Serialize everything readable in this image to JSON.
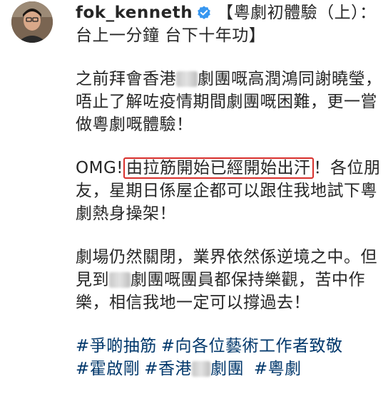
{
  "post": {
    "username": "fok_kenneth",
    "title": "【粵劇初體驗（上）：台上一分鐘 台下十年功】",
    "para1_a": "之前拜會香港",
    "para1_b": "劇團嘅高潤鴻同謝曉瑩，唔止了解咗疫情期間劇團嘅困難，更一嘗做粵劇嘅體驗！",
    "para2_a": "OMG!",
    "para2_highlight": "由拉筋開始已經開始出汗",
    "para2_b": "！各位朋友，星期日係屋企都可以跟住我地試下粵劇熱身操架！",
    "para3_a": "劇場仍然關閉，業界依然係逆境之中。但見到",
    "para3_b": "劇團嘅團員都保持樂觀，苦中作樂，相信我地一定可以撐過去！",
    "tag1": "#爭啲抽筋",
    "tag2": "#向各位藝術工作者致敬",
    "tag3": "#霍啟剛",
    "tag4_a": "#香港",
    "tag4_b": "劇團",
    "tag5": "#粵劇"
  },
  "colors": {
    "text": "#262626",
    "hashtag": "#00376b",
    "verified": "#3897f0",
    "highlight_box": "#d8302c"
  },
  "icons": {
    "verified": "verified-badge-icon",
    "avatar": "profile-avatar"
  }
}
